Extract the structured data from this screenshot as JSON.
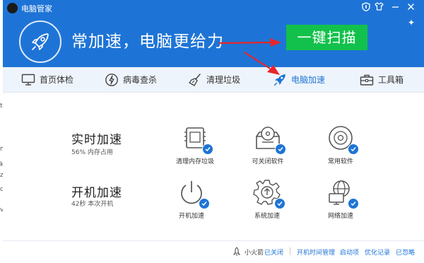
{
  "window": {
    "title": "电脑管家",
    "banner_slogan": "常加速，电脑更给力",
    "scan_button": "一键扫描"
  },
  "tabs": [
    {
      "label": "首页体检",
      "icon": "monitor-icon"
    },
    {
      "label": "病毒查杀",
      "icon": "shield-bolt-icon"
    },
    {
      "label": "清理垃圾",
      "icon": "broom-icon"
    },
    {
      "label": "电脑加速",
      "icon": "rocket-icon",
      "active": true
    },
    {
      "label": "工具箱",
      "icon": "toolbox-icon"
    }
  ],
  "realtime": {
    "title": "实时加速",
    "sub": "56% 内存占用",
    "items": [
      {
        "label": "清理内存垃圾",
        "icon": "memory-chip-icon"
      },
      {
        "label": "可关闭软件",
        "icon": "disc-box-icon"
      },
      {
        "label": "常用软件",
        "icon": "cd-icon"
      }
    ]
  },
  "startup": {
    "title": "开机加速",
    "sub": "42秒 本次开机",
    "items": [
      {
        "label": "开机加速",
        "icon": "power-icon"
      },
      {
        "label": "系统加速",
        "icon": "gear-icon"
      },
      {
        "label": "网络加速",
        "icon": "globe-monitor-icon"
      }
    ]
  },
  "footer": {
    "fire_label": "小火箭",
    "fire_status": "已关闭",
    "links": [
      "开机时间管理",
      "启动项",
      "优化记录",
      "已忽略"
    ]
  },
  "colors": {
    "brand_blue": "#1e74d6",
    "scan_green": "#12c14b",
    "annotation_red": "#e8262a"
  }
}
